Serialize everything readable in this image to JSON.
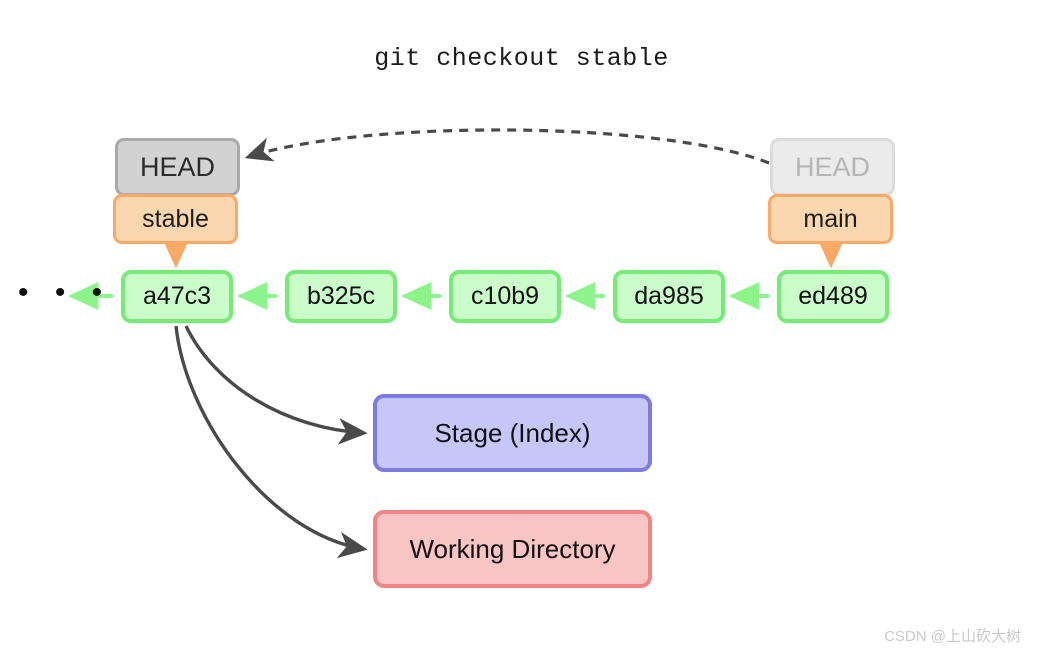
{
  "title": "git checkout stable",
  "refs": {
    "left": {
      "head_label": "HEAD",
      "branch_label": "stable",
      "state": "active"
    },
    "right": {
      "head_label": "HEAD",
      "branch_label": "main",
      "state": "faded"
    }
  },
  "commits": [
    {
      "hash": "a47c3"
    },
    {
      "hash": "b325c"
    },
    {
      "hash": "c10b9"
    },
    {
      "hash": "da985"
    },
    {
      "hash": "ed489"
    }
  ],
  "ellipsis": "• • •",
  "areas": {
    "stage": "Stage (Index)",
    "working_directory": "Working Directory"
  },
  "watermark": "CSDN @上山砍大树",
  "colors": {
    "head_active_fill": "#d2d2d2",
    "head_active_border": "#a9a9a9",
    "head_faded_fill": "#ebebeb",
    "head_faded_border": "#dcdcdc",
    "branch_fill": "#fbd7b0",
    "branch_border": "#f9a865",
    "commit_fill": "#cbfdcb",
    "commit_border": "#76ec76",
    "stage_fill": "#c6c6f8",
    "stage_border": "#7b7ce2",
    "workdir_fill": "#f9c4c4",
    "workdir_border": "#f08585",
    "arrow_dark": "#4a4a4a",
    "arrow_green": "#8bf58b",
    "arrow_orange": "#f9a865",
    "text_dark": "#111111",
    "watermark": "#c9c9c9"
  }
}
